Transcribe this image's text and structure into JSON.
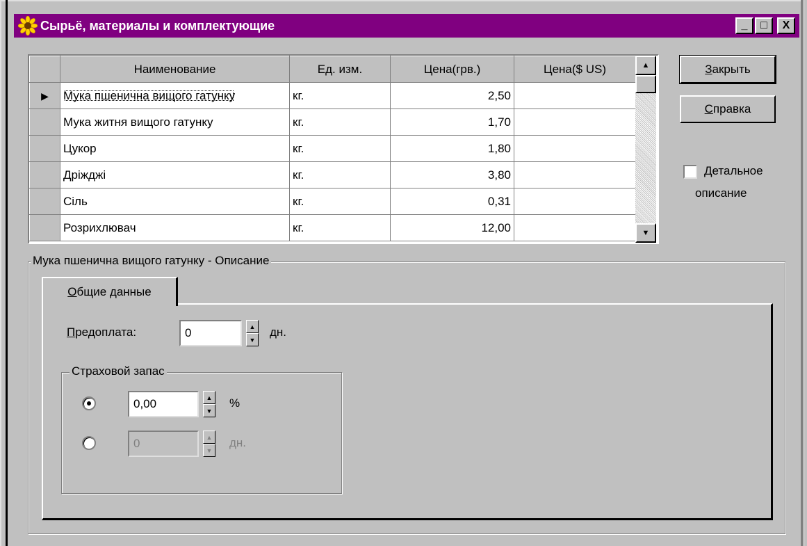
{
  "window": {
    "title": "Сырьё, материалы и комплектующие",
    "controls": {
      "minimize": "_",
      "maximize": "□",
      "close": "X"
    }
  },
  "grid": {
    "columns": [
      "Наименование",
      "Ед. изм.",
      "Цена(грв.)",
      "Цена($ US)"
    ],
    "rows": [
      {
        "name": "Мука пшенична вищого гатунку",
        "unit": "кг.",
        "price_uah": "2,50",
        "price_usd": ""
      },
      {
        "name": "Мука житня вищого гатунку",
        "unit": "кг.",
        "price_uah": "1,70",
        "price_usd": ""
      },
      {
        "name": "Цукор",
        "unit": "кг.",
        "price_uah": "1,80",
        "price_usd": ""
      },
      {
        "name": "Дріжджі",
        "unit": "кг.",
        "price_uah": "3,80",
        "price_usd": ""
      },
      {
        "name": "Сіль",
        "unit": "кг.",
        "price_uah": "0,31",
        "price_usd": ""
      },
      {
        "name": "Розрихлювач",
        "unit": "кг.",
        "price_uah": "12,00",
        "price_usd": ""
      }
    ],
    "current_row_marker": "▶"
  },
  "buttons": {
    "close": {
      "hotkey": "З",
      "rest": "акрыть"
    },
    "help": {
      "hotkey": "С",
      "rest": "правка"
    }
  },
  "detail_checkbox": {
    "hotkey": "Д",
    "line1_rest": "етальное",
    "line2": "описание",
    "checked": false
  },
  "description_group": {
    "legend": "Мука пшенична вищого гатунку - Описание",
    "tab": {
      "hotkey": "О",
      "rest": "бщие данные"
    },
    "prepay": {
      "hotkey": "П",
      "rest": "редоплата:",
      "value": "0",
      "unit": "дн."
    },
    "safety_stock": {
      "legend": "Страховой запас",
      "percent": {
        "value": "0,00",
        "unit": "%",
        "selected": true
      },
      "days": {
        "value": "0",
        "unit": "дн.",
        "selected": false
      }
    }
  },
  "colors": {
    "titlebar": "#800080",
    "face": "#c0c0c0"
  }
}
